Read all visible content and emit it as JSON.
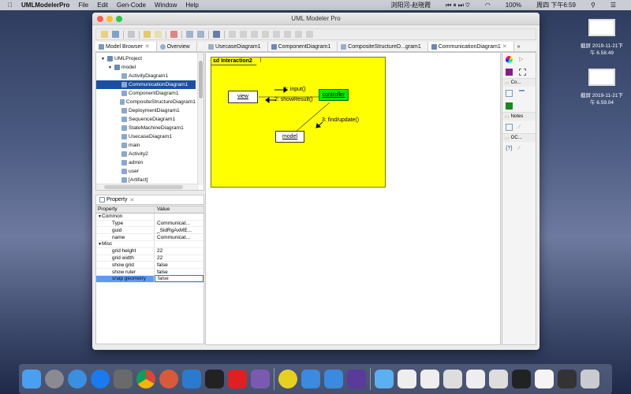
{
  "menubar": {
    "app": "UMLModelerPro",
    "items": [
      "File",
      "Edit",
      "Gen-Code",
      "Window",
      "Help"
    ],
    "now_playing": "浏阳河-赵晓霞",
    "battery": "100%",
    "clock": "周四 下午6:59"
  },
  "desktop": {
    "icons": [
      {
        "label1": "截屏 2019-11-21下",
        "label2": "午 6.58.49"
      },
      {
        "label1": "截屏 2019-11-21下",
        "label2": "午 6.59.04"
      }
    ]
  },
  "window": {
    "title": "UML Modeler Pro"
  },
  "left_tabs": [
    {
      "label": "Model Browser"
    },
    {
      "label": "Overview"
    }
  ],
  "editor_tabs": [
    {
      "label": "UsecaseDiagram1"
    },
    {
      "label": "ComponentDiagram1"
    },
    {
      "label": "CompositeStructureD...gram1"
    },
    {
      "label": "CommunicationDiagram1"
    }
  ],
  "overflow_label": "»",
  "tree": [
    {
      "label": "UMLProject",
      "level": 0,
      "expand": "▼"
    },
    {
      "label": "model",
      "level": 1,
      "expand": "▼"
    },
    {
      "label": "ActivityDiagram1",
      "level": 2
    },
    {
      "label": "CommunicationDiagram1",
      "level": 2,
      "selected": true
    },
    {
      "label": "ComponentDiagram1",
      "level": 2
    },
    {
      "label": "CompositeStructureDiagram1",
      "level": 2
    },
    {
      "label": "DeploymentDiagram1",
      "level": 2
    },
    {
      "label": "SequenceDiagram1",
      "level": 2
    },
    {
      "label": "StateMachineDiagram1",
      "level": 2
    },
    {
      "label": "UsecaseDiagram1",
      "level": 2
    },
    {
      "label": "main",
      "level": 2
    },
    {
      "label": "Activity2",
      "level": 2
    },
    {
      "label": "admin",
      "level": 2
    },
    {
      "label": "user",
      "level": 2
    },
    {
      "label": "[Artifact]",
      "level": 2
    }
  ],
  "property_panel": {
    "title": "Property",
    "col_property": "Property",
    "col_value": "Value",
    "rows": [
      {
        "k": "Common",
        "v": "",
        "group": true
      },
      {
        "k": "Type",
        "v": "Communicat..."
      },
      {
        "k": "guid",
        "v": "_SidRgAxME..."
      },
      {
        "k": "name",
        "v": "Communicat..."
      },
      {
        "k": "Misc",
        "v": "",
        "group": true
      },
      {
        "k": "grid height",
        "v": "22"
      },
      {
        "k": "grid width",
        "v": "22"
      },
      {
        "k": "show grid",
        "v": "false"
      },
      {
        "k": "show ruler",
        "v": "false"
      },
      {
        "k": "snap geometry",
        "v": "false",
        "selected": true
      }
    ]
  },
  "diagram": {
    "frame_label": "sd  Interaction2",
    "objects": {
      "view": "view",
      "controller": "controller",
      "model": "model"
    },
    "messages": [
      "1: input()",
      "2: showResult()",
      "3: find/update()"
    ],
    "colors": {
      "frame": "#ffff00",
      "controller": "#00ee00"
    }
  },
  "palette": {
    "groups": [
      "Co...",
      "Notes",
      "OC..."
    ]
  },
  "colors": {
    "selection": "#1c4f9f",
    "prop_selection": "#5a9df0"
  }
}
